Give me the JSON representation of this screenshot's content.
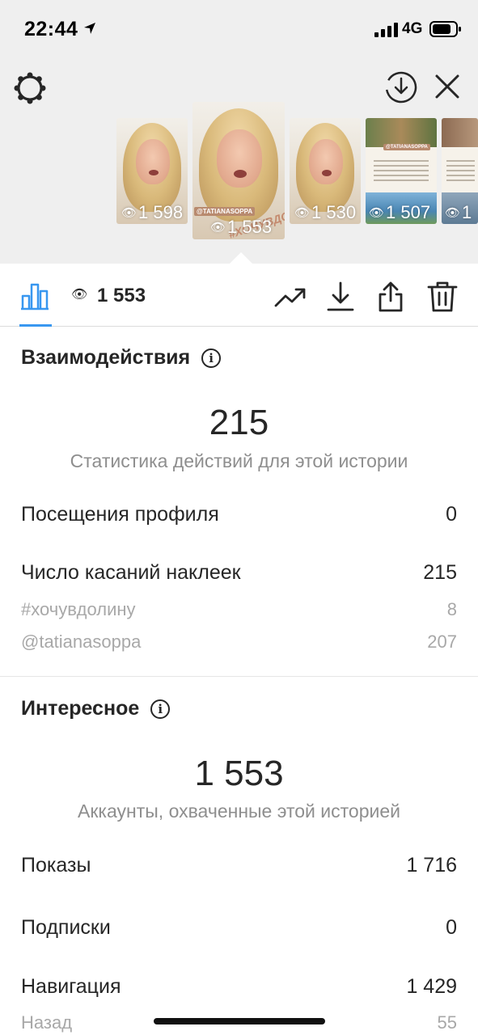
{
  "status_bar": {
    "time": "22:44",
    "network": "4G"
  },
  "stories": [
    {
      "views": "1 598"
    },
    {
      "views": "1 553",
      "tag": "@TATIANASOPPA",
      "hashtag": "#ХОЧУВДОЛИНУ"
    },
    {
      "views": "1 530"
    },
    {
      "views": "1 507",
      "tag": "@TATIANASOPPA"
    },
    {
      "views": "1"
    }
  ],
  "toolbar": {
    "view_count": "1 553"
  },
  "interactions": {
    "title": "Взаимодействия",
    "total": "215",
    "total_caption": "Статистика действий для этой истории",
    "rows": [
      {
        "label": "Посещения профиля",
        "value": "0"
      },
      {
        "label": "Число касаний наклеек",
        "value": "215"
      }
    ],
    "sub_rows": [
      {
        "label": "#хочувдолину",
        "value": "8"
      },
      {
        "label": "@tatianasoppa",
        "value": "207"
      }
    ]
  },
  "discovery": {
    "title": "Интересное",
    "total": "1 553",
    "total_caption": "Аккаунты, охваченные этой историей",
    "rows": [
      {
        "label": "Показы",
        "value": "1 716"
      },
      {
        "label": "Подписки",
        "value": "0"
      },
      {
        "label": "Навигация",
        "value": "1 429"
      }
    ],
    "sub_rows": [
      {
        "label": "Назад",
        "value": "55"
      }
    ]
  }
}
